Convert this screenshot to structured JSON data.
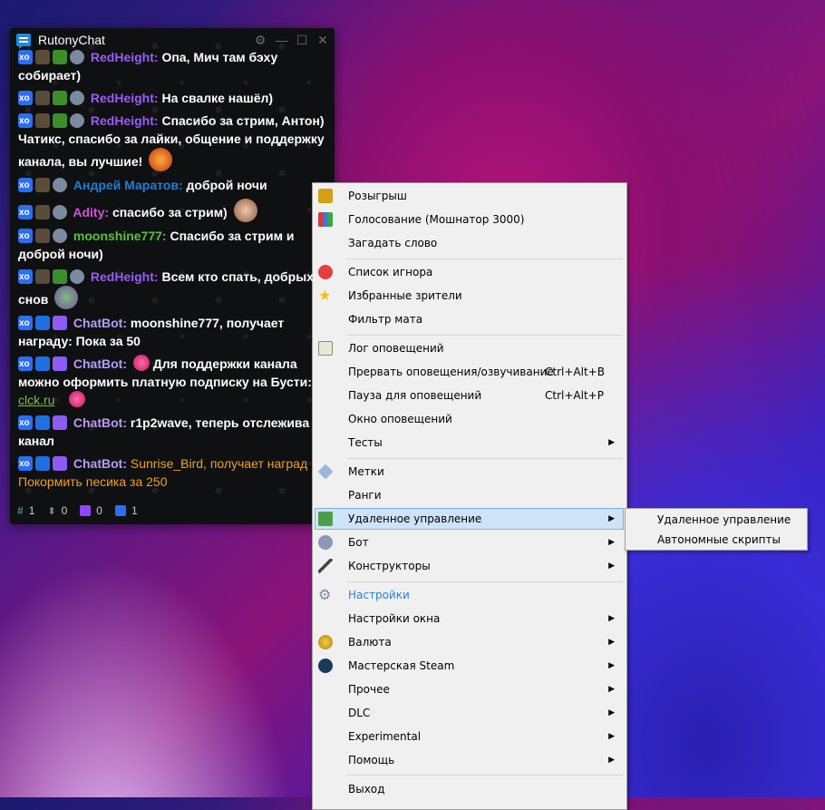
{
  "chat": {
    "title": "RutonyChat",
    "messages": [
      {
        "name": "RedHeight:",
        "name_color": "#9b5cf6",
        "text": "Опа, Мич там бэху собирает)"
      },
      {
        "name": "RedHeight:",
        "name_color": "#9b5cf6",
        "text": "На свалке нашёл)"
      },
      {
        "name": "RedHeight:",
        "name_color": "#9b5cf6",
        "text": "Спасибо за стрим, Антон) Чатикс, спасибо за лайки, общение и поддержку канала, вы лучшие!"
      },
      {
        "name": "Андрей Маратов:",
        "name_color": "#1e7fd6",
        "text": "доброй ночи"
      },
      {
        "name": "Adity:",
        "name_color": "#d64fd6",
        "text": "спасибо за стрим)"
      },
      {
        "name": "moonshine777:",
        "name_color": "#5fbf3a",
        "text": "Спасибо за стрим и доброй ночи)"
      },
      {
        "name": "RedHeight:",
        "name_color": "#9b5cf6",
        "text": "Всем кто спать, добрых снов"
      },
      {
        "name": "ChatBot:",
        "name_color": "#b79cf6",
        "text": "moonshine777, получает награду: Пока за 50"
      },
      {
        "name": "ChatBot:",
        "name_color": "#b79cf6",
        "text": "Для поддержки канала можно оформить платную подписку на Бусти:",
        "link": "clck.ru"
      },
      {
        "name": "ChatBot:",
        "name_color": "#b79cf6",
        "text": "r1p2wave, теперь отслежива канал"
      },
      {
        "name": "ChatBot:",
        "name_color": "#b79cf6",
        "text": "Sunrise_Bird, получает наград Покормить песика за 250",
        "text_color": "#f0a020"
      }
    ],
    "status": {
      "hash_count": "1",
      "arrows_count": "0",
      "twitch_count": "0",
      "boosty_count": "1"
    }
  },
  "menu": {
    "items": [
      {
        "label": "Розыгрыш",
        "icon": "trophy-icon"
      },
      {
        "label": "Голосование (Мошнатор 3000)",
        "icon": "bar-chart-icon"
      },
      {
        "label": "Загадать слово",
        "icon": ""
      },
      {
        "label": "Список игнора",
        "icon": "block-icon"
      },
      {
        "label": "Избранные зрители",
        "icon": "star-icon"
      },
      {
        "label": "Фильтр мата",
        "icon": ""
      },
      {
        "label": "Лог оповещений",
        "icon": "log-icon"
      },
      {
        "label": "Прервать оповещения/озвучивание",
        "shortcut": "Ctrl+Alt+B"
      },
      {
        "label": "Пауза для оповещений",
        "shortcut": "Ctrl+Alt+P"
      },
      {
        "label": "Окно оповещений"
      },
      {
        "label": "Тесты",
        "submenu": true
      },
      {
        "label": "Метки",
        "icon": "tag-icon"
      },
      {
        "label": "Ранги"
      },
      {
        "label": "Удаленное управление",
        "icon": "remote-icon",
        "submenu": true,
        "highlighted": true
      },
      {
        "label": "Бот",
        "icon": "bot-icon",
        "submenu": true
      },
      {
        "label": "Конструкторы",
        "icon": "wand-icon",
        "submenu": true
      },
      {
        "label": "Настройки",
        "icon": "gear-icon",
        "color": "#2a7fd4"
      },
      {
        "label": "Настройки окна",
        "submenu": true
      },
      {
        "label": "Валюта",
        "icon": "coins-icon",
        "submenu": true
      },
      {
        "label": "Мастерская Steam",
        "icon": "steam-icon",
        "submenu": true
      },
      {
        "label": "Прочее",
        "submenu": true
      },
      {
        "label": "DLC",
        "submenu": true
      },
      {
        "label": "Experimental",
        "submenu": true
      },
      {
        "label": "Помощь",
        "submenu": true
      },
      {
        "label": "Выход"
      }
    ],
    "submenu_items": [
      "Удаленное управление",
      "Автономные скрипты"
    ]
  }
}
